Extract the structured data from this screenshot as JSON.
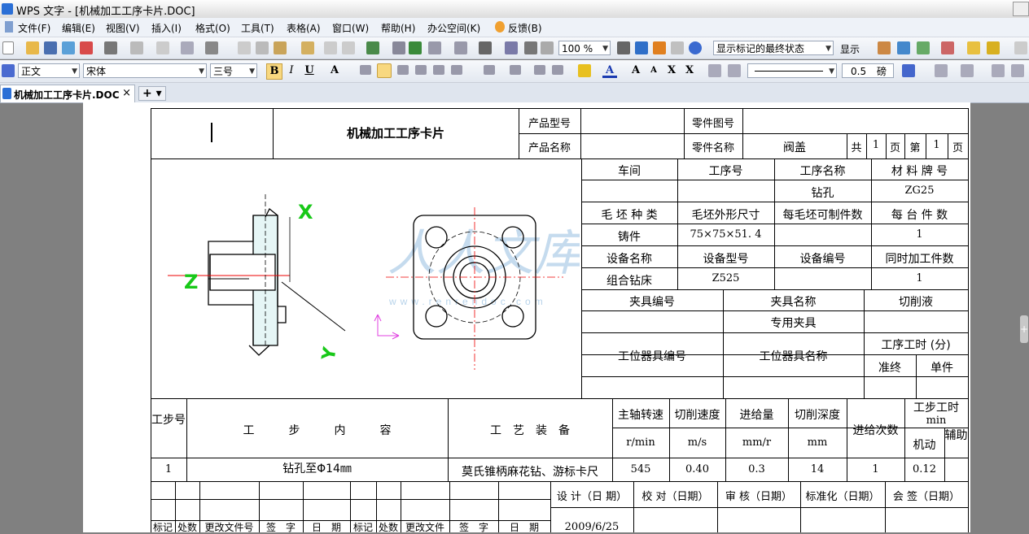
{
  "window": {
    "title": "WPS 文字 - [机械加工工序卡片.DOC]"
  },
  "menu": [
    "文件(F)",
    "编辑(E)",
    "视图(V)",
    "插入(I)",
    "格式(O)",
    "工具(T)",
    "表格(A)",
    "窗口(W)",
    "帮助(H)",
    "办公空间(K)",
    "反馈(B)"
  ],
  "toolbar": {
    "zoom": "100 %",
    "markup_view": "显示标记的最终状态",
    "show_label": "显示"
  },
  "format_bar": {
    "style": "正文",
    "font": "宋体",
    "size": "三号",
    "line_width": "0.5",
    "line_unit": "磅"
  },
  "tabs": {
    "document": "机械加工工序卡片.DOC"
  },
  "card": {
    "title": "机械加工工序卡片",
    "h_product_model": "产品型号",
    "h_part_drawing_no": "零件图号",
    "h_product_name": "产品名称",
    "h_part_name": "零件名称",
    "part_name": "阀盖",
    "total_label": "共",
    "total_pages": "1",
    "page_label": "页",
    "no_label": "第",
    "page_no": "1",
    "page_label2": "页",
    "h_workshop": "车间",
    "h_op_no": "工序号",
    "h_op_name": "工序名称",
    "h_material": "材 料 牌 号",
    "op_name": "钻孔",
    "material": "ZG25",
    "h_blank_type": "毛 坯 种 类",
    "h_blank_size": "毛坯外形尺寸",
    "h_per_blank": "每毛坯可制件数",
    "h_per_machine": "每 台 件 数",
    "blank_type": "铸件",
    "blank_size": "75×75×51. 4",
    "per_machine": "1",
    "h_equip_name": "设备名称",
    "h_equip_model": "设备型号",
    "h_equip_no": "设备编号",
    "h_simul": "同时加工件数",
    "equip_name": "组合钻床",
    "equip_model": "Z525",
    "simul": "1",
    "h_fixture_no": "夹具编号",
    "h_fixture_name": "夹具名称",
    "h_coolant": "切削液",
    "fixture_name": "专用夹具",
    "h_station_no": "工位器具编号",
    "h_station_name": "工位器具名称",
    "h_op_time": "工序工时 (分)",
    "h_prep_final": "准终",
    "h_unit": "单件",
    "h_step_no": "工步号",
    "h_step_content": "工　　　步　　　内　　　容",
    "h_equipment": "工　艺　装　备",
    "h_spindle": "主轴转速",
    "h_cut_speed": "切削速度",
    "h_feed": "进给量",
    "h_cut_depth": "切削深度",
    "h_passes": "进给次数",
    "h_step_time": "工步工时",
    "h_step_time_unit": "min",
    "u_spindle": "r/min",
    "u_cut_speed": "m/s",
    "u_feed": "mm/r",
    "u_depth": "mm",
    "h_machine": "机动",
    "h_aux": "辅助",
    "step_no": "1",
    "step_content": "钻孔至Φ14㎜",
    "step_equipment": "莫氏锥柄麻花钻、游标卡尺",
    "spindle": "545",
    "cut_speed": "0.40",
    "feed": "0.3",
    "depth": "14",
    "passes": "1",
    "machine_time": "0.12",
    "h_design": "设 计（日 期）",
    "h_check": "校 对（日期）",
    "h_review": "审 核（日期）",
    "h_standard": "标准化（日期）",
    "h_sign": "会 签（日期）",
    "design_date": "2009/6/25",
    "b_mark": "标记",
    "b_count": "处数",
    "b_change_doc": "更改文件号",
    "b_sign": "签　字",
    "b_date": "日　期",
    "b_mark2": "标记",
    "b_count2": "处数",
    "b_change_doc2": "更改文件",
    "b_sign2": "签　字",
    "b_date2": "日　期"
  },
  "drawing": {
    "axis_x": "X",
    "axis_z": "Z",
    "axis_y": "Y",
    "watermark": "人人文库",
    "watermark_url": "www.renrendoc.com"
  }
}
